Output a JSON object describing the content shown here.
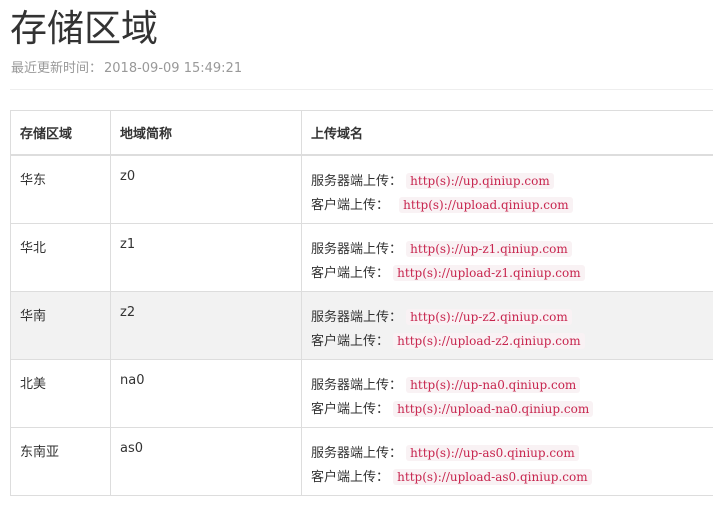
{
  "page": {
    "title": "存储区域",
    "updated_label": "最近更新时间：",
    "updated_time": "2018-09-09 15:49:21"
  },
  "table": {
    "headers": [
      "存储区域",
      "地域简称",
      "上传域名"
    ],
    "rows": [
      {
        "region": "华东",
        "abbr": "z0",
        "server_label": "服务器端上传：",
        "server_url": "http(s)://up.qiniup.com",
        "client_label": "客户端上传：",
        "client_url": "http(s)://upload.qiniup.com"
      },
      {
        "region": "华北",
        "abbr": "z1",
        "server_label": "服务器端上传：",
        "server_url": "http(s)://up-z1.qiniup.com",
        "client_label": "客户端上传：",
        "client_url": "http(s)://upload-z1.qiniup.com"
      },
      {
        "region": "华南",
        "abbr": "z2",
        "server_label": "服务器端上传：",
        "server_url": "http(s)://up-z2.qiniup.com",
        "client_label": "客户端上传：",
        "client_url": "http(s)://upload-z2.qiniup.com"
      },
      {
        "region": "北美",
        "abbr": "na0",
        "server_label": "服务器端上传：",
        "server_url": "http(s)://up-na0.qiniup.com",
        "client_label": "客户端上传：",
        "client_url": "http(s)://upload-na0.qiniup.com"
      },
      {
        "region": "东南亚",
        "abbr": "as0",
        "server_label": "服务器端上传：",
        "server_url": "http(s)://up-as0.qiniup.com",
        "client_label": "客户端上传：",
        "client_url": "http(s)://upload-as0.qiniup.com"
      }
    ]
  },
  "colors": {
    "code_text": "#c7254e",
    "code_background": "#f9f2f4",
    "shaded_row": "#f2f2f2",
    "border": "#dddddd",
    "muted_text": "#999999"
  }
}
